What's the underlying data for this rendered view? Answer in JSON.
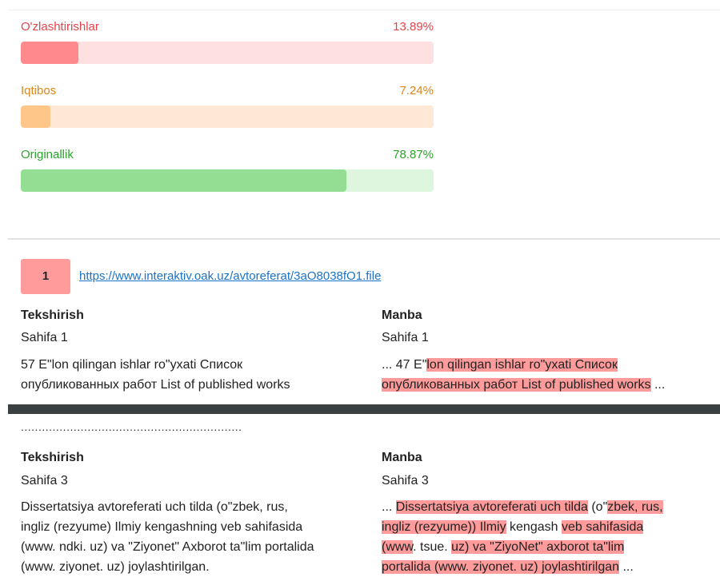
{
  "metrics": [
    {
      "label": "O'zlashtirishlar",
      "value": "13.89%",
      "pct": 13.89,
      "color": "#e5434a",
      "fill": "#ff8a8e",
      "track": "#ffe0e1"
    },
    {
      "label": "Iqtibos",
      "value": "7.24%",
      "pct": 7.24,
      "color": "#e0861a",
      "fill": "#ffc68a",
      "track": "#ffe8d6"
    },
    {
      "label": "Originallik",
      "value": "78.87%",
      "pct": 78.87,
      "color": "#2aa52a",
      "fill": "#93de93",
      "track": "#ddf6dd"
    }
  ],
  "source": {
    "index": "1",
    "url": "https://www.interaktiv.oak.uz/avtoreferat/3aO8038fO1.file"
  },
  "columns": {
    "left": "Tekshirish",
    "right": "Manba"
  },
  "match1": {
    "left_page": "Sahifa 1",
    "right_page": "Sahifa 1",
    "left_text": [
      "57 E\"lon qilingan ishlar ro\"yxati Список",
      "опубликованных работ List of published works"
    ],
    "right_prefix": "... 47 E\"",
    "right_hl1": "lon qilingan ishlar ro\"yxati Список",
    "right_hl2": "опубликованных работ List of published works",
    "right_suffix": " ..."
  },
  "divider_dots": "...............................................................",
  "match2": {
    "left_page": "Sahifa 3",
    "right_page": "Sahifa 3",
    "left_text": [
      "Dissertatsiya avtoreferati uch tilda (o\"zbek, rus,",
      "ingliz (rezyume) Ilmiy kengashning veb sahifasida",
      "(www. ndki. uz) va \"Ziyonet\" Axborot ta\"lim portalida",
      "(www. ziyonet. uz) joylashtirilgan."
    ],
    "r_l1_a": "... ",
    "r_l1_h1": "Dissertatsiya avtoreferati uch tilda",
    "r_l1_b": " (o\"",
    "r_l1_h2": "zbek, rus,",
    "r_l2_h1": "ingliz (rezyume)) Ilmiy",
    "r_l2_b": " kengash ",
    "r_l2_h2": "veb sahifasida",
    "r_l3_h1": "(www",
    "r_l3_b": ". tsue. ",
    "r_l3_h2": "uz) va \"ZiyoNet\" axborot ta\"lim",
    "r_l4_h1": "portalida (www. ziyonet. uz) joylashtirilgan",
    "r_l4_b": " ..."
  }
}
